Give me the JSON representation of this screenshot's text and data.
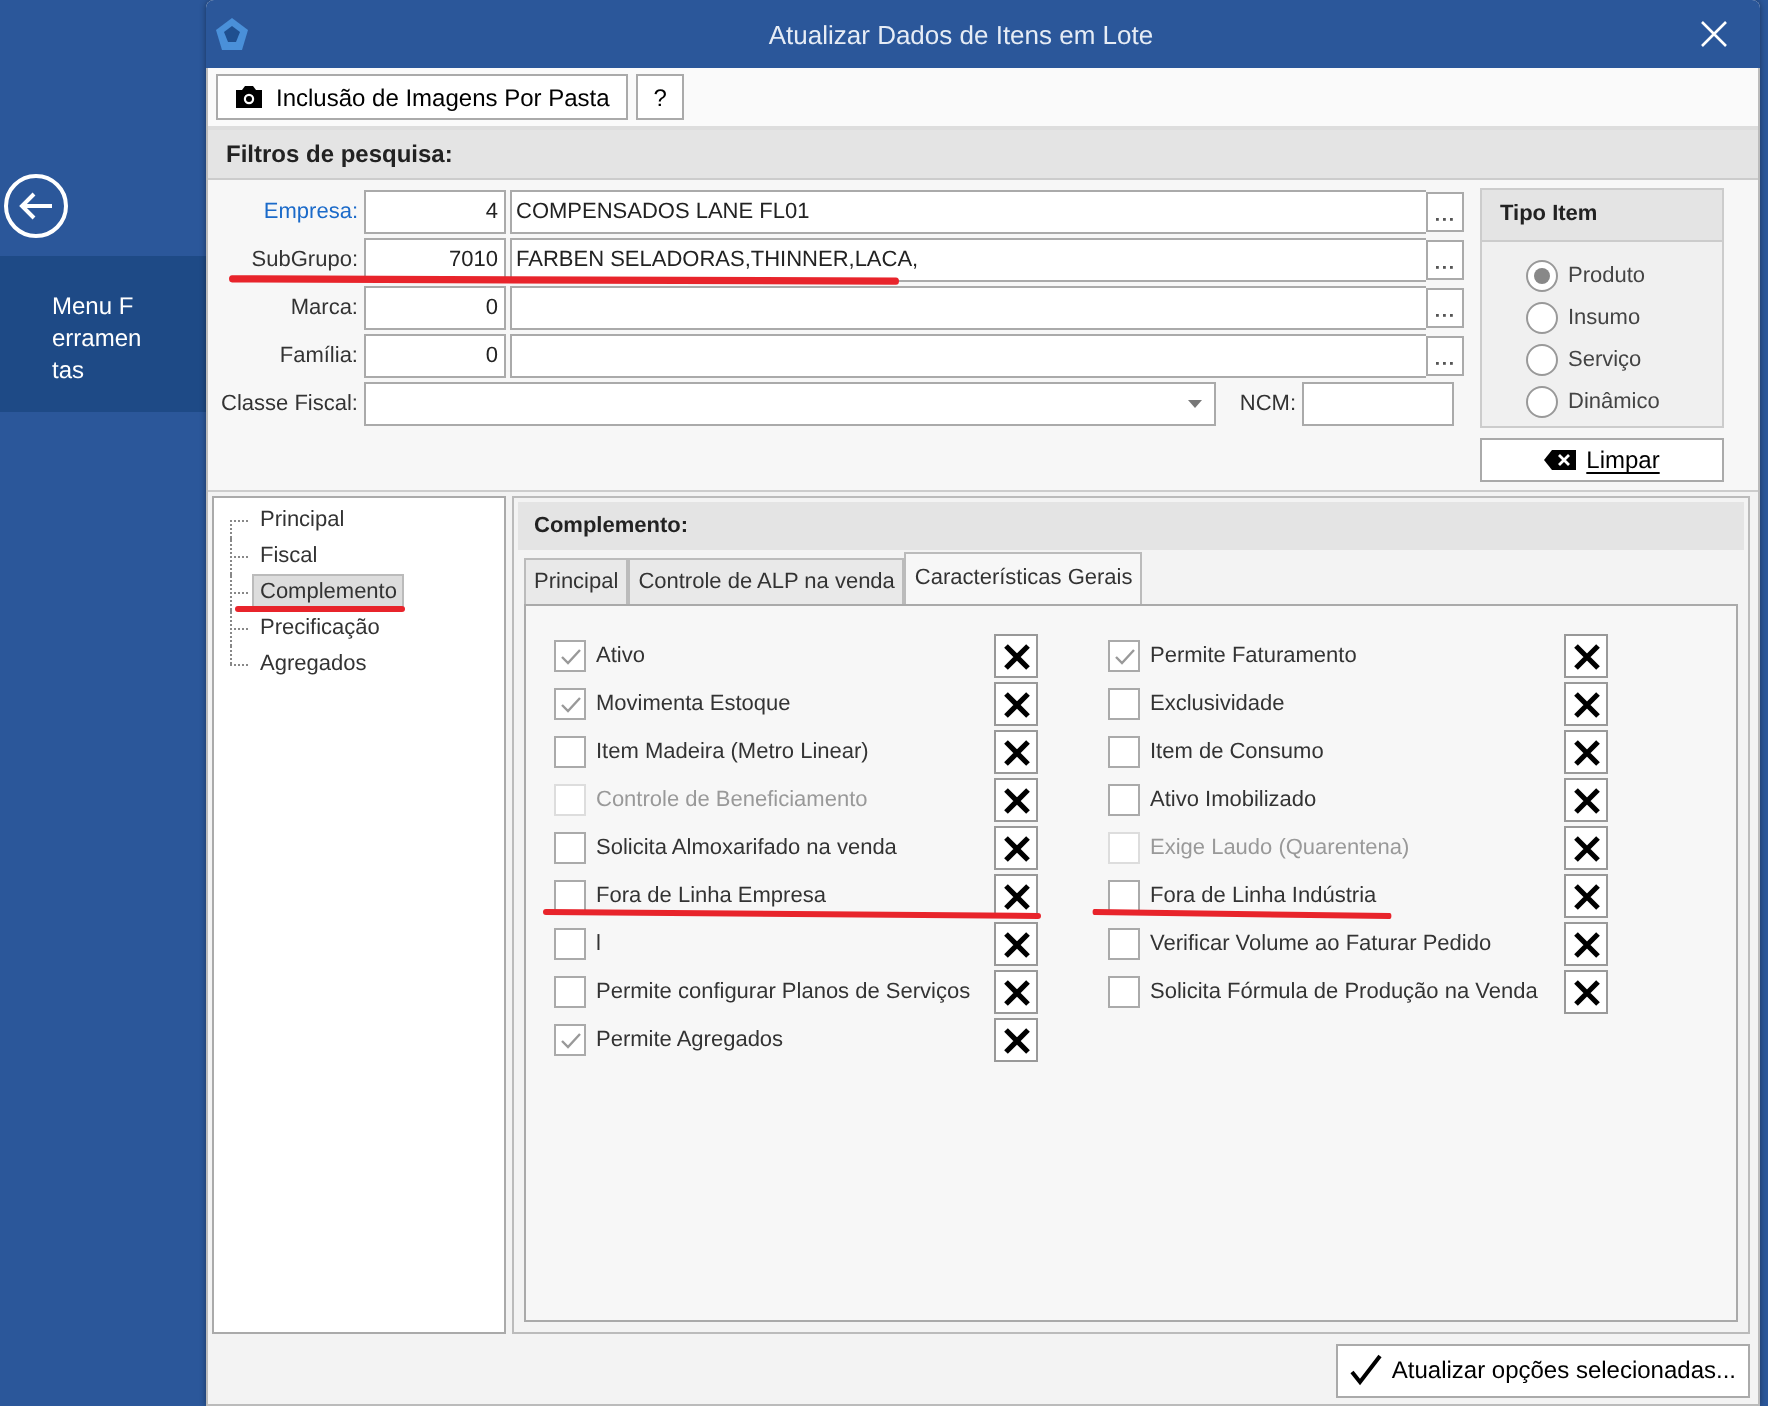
{
  "side_menu": {
    "label": "Menu Ferramentas"
  },
  "window": {
    "title": "Atualizar Dados de Itens em Lote"
  },
  "toolbar": {
    "buttons": [
      {
        "kind": "camera",
        "label": "Inclusão de Imagens Por Pasta"
      },
      {
        "kind": "plain",
        "label": "?"
      }
    ]
  },
  "filters": {
    "title": "Filtros de pesquisa:",
    "fields": [
      {
        "kind": "lookup",
        "label": "Empresa:",
        "link": true,
        "code": "4",
        "description": "COMPENSADOS LANE FL01",
        "marked": false
      },
      {
        "kind": "lookup",
        "label": "SubGrupo:",
        "link": false,
        "code": "7010",
        "description": "FARBEN SELADORAS,THINNER,LACA,",
        "marked": true
      },
      {
        "kind": "lookup",
        "label": "Marca:",
        "link": false,
        "code": "0",
        "marked": false
      },
      {
        "kind": "lookup",
        "label": "Família:",
        "link": false,
        "code": "0",
        "marked": false
      },
      {
        "kind": "combo",
        "label": "Classe Fiscal:",
        "link": false,
        "extra_label": "NCM:",
        "marked": false
      }
    ],
    "tipo_item": {
      "title": "Tipo Item",
      "options": [
        {
          "label": "Produto",
          "selected": true
        },
        {
          "label": "Insumo",
          "selected": false
        },
        {
          "label": "Serviço",
          "selected": false
        },
        {
          "label": "Dinâmico",
          "selected": false
        }
      ]
    },
    "clear_button": "Limpar"
  },
  "tree": [
    {
      "label": "Principal",
      "selected": false,
      "marked": false
    },
    {
      "label": "Fiscal",
      "selected": false,
      "marked": false
    },
    {
      "label": "Complemento",
      "selected": true,
      "marked": true
    },
    {
      "label": "Precificação",
      "selected": false,
      "marked": false
    },
    {
      "label": "Agregados",
      "selected": false,
      "marked": false
    }
  ],
  "panel": {
    "title": "Complemento:",
    "tabs": [
      {
        "label": "Principal",
        "selected": false
      },
      {
        "label": "Controle de ALP na venda",
        "selected": false
      },
      {
        "label": "Características Gerais",
        "selected": true
      }
    ],
    "columns": [
      [
        {
          "label": "Ativo",
          "checked": true,
          "disabled": false,
          "marked": false
        },
        {
          "label": "Movimenta Estoque",
          "checked": true,
          "disabled": false,
          "marked": false
        },
        {
          "label": "Item Madeira (Metro Linear)",
          "checked": false,
          "disabled": false,
          "marked": false
        },
        {
          "label": "Controle de Beneficiamento",
          "checked": false,
          "disabled": true,
          "marked": false
        },
        {
          "label": "Solicita Almoxarifado na venda",
          "checked": false,
          "disabled": false,
          "marked": false
        },
        {
          "label": "Fora de Linha Empresa",
          "checked": false,
          "disabled": false,
          "marked": true
        },
        {
          "label": "l",
          "checked": false,
          "disabled": false,
          "marked": false
        },
        {
          "label": "Permite configurar Planos de Serviços",
          "checked": false,
          "disabled": false,
          "marked": false
        },
        {
          "label": "Permite Agregados",
          "checked": true,
          "disabled": false,
          "marked": false
        }
      ],
      [
        {
          "label": "Permite Faturamento",
          "checked": true,
          "disabled": false,
          "marked": false
        },
        {
          "label": "Exclusividade",
          "checked": false,
          "disabled": false,
          "marked": false
        },
        {
          "label": "Item de Consumo",
          "checked": false,
          "disabled": false,
          "marked": false
        },
        {
          "label": "Ativo Imobilizado",
          "checked": false,
          "disabled": false,
          "marked": false
        },
        {
          "label": "Exige Laudo (Quarentena)",
          "checked": false,
          "disabled": true,
          "marked": false
        },
        {
          "label": "Fora de Linha Indústria",
          "checked": false,
          "disabled": false,
          "marked": true
        },
        {
          "label": "Verificar Volume ao Faturar Pedido",
          "checked": false,
          "disabled": false,
          "marked": false
        },
        {
          "label": "Solicita Fórmula de Produção na Venda",
          "checked": false,
          "disabled": false,
          "marked": false
        }
      ]
    ]
  },
  "footer": {
    "button": "Atualizar opções selecionadas..."
  }
}
